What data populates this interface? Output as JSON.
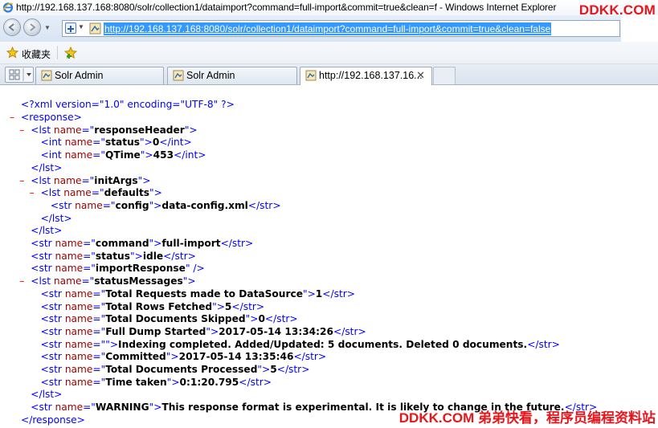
{
  "window": {
    "title": "http://192.168.137.168:8080/solr/collection1/dataimport?command=full-import&commit=true&clean=f - Windows Internet Explorer"
  },
  "watermark": {
    "top": "DDKK.COM",
    "bottom": "DDKK.COM 弟弟快看，程序员编程资料站"
  },
  "address": {
    "url": "http://192.168.137.168:8080/solr/collection1/dataimport?command=full-import&commit=true&clean=false"
  },
  "favorites": {
    "label": "收藏夹"
  },
  "tabs": [
    {
      "label": "Solr Admin"
    },
    {
      "label": "Solr Admin"
    },
    {
      "label": "http://192.168.137.16..."
    }
  ],
  "xml": {
    "declaration": "<?xml version=\"1.0\" encoding=\"UTF-8\" ?>",
    "lines": [
      {
        "collapse": true,
        "indent": 0,
        "kind": "open",
        "tag": "response"
      },
      {
        "collapse": true,
        "indent": 1,
        "kind": "open",
        "tag": "lst",
        "name": "responseHeader"
      },
      {
        "collapse": false,
        "indent": 2,
        "kind": "elem",
        "tag": "int",
        "name": "status",
        "value": "0"
      },
      {
        "collapse": false,
        "indent": 2,
        "kind": "elem",
        "tag": "int",
        "name": "QTime",
        "value": "453"
      },
      {
        "collapse": false,
        "indent": 1,
        "kind": "close",
        "tag": "lst"
      },
      {
        "collapse": true,
        "indent": 1,
        "kind": "open",
        "tag": "lst",
        "name": "initArgs"
      },
      {
        "collapse": true,
        "indent": 2,
        "kind": "open",
        "tag": "lst",
        "name": "defaults"
      },
      {
        "collapse": false,
        "indent": 3,
        "kind": "elem",
        "tag": "str",
        "name": "config",
        "value": "data-config.xml"
      },
      {
        "collapse": false,
        "indent": 2,
        "kind": "close",
        "tag": "lst"
      },
      {
        "collapse": false,
        "indent": 1,
        "kind": "close",
        "tag": "lst"
      },
      {
        "collapse": false,
        "indent": 1,
        "kind": "elem",
        "tag": "str",
        "name": "command",
        "value": "full-import"
      },
      {
        "collapse": false,
        "indent": 1,
        "kind": "elem",
        "tag": "str",
        "name": "status",
        "value": "idle"
      },
      {
        "collapse": false,
        "indent": 1,
        "kind": "empty",
        "tag": "str",
        "name": "importResponse"
      },
      {
        "collapse": true,
        "indent": 1,
        "kind": "open",
        "tag": "lst",
        "name": "statusMessages"
      },
      {
        "collapse": false,
        "indent": 2,
        "kind": "elem",
        "tag": "str",
        "name": "Total Requests made to DataSource",
        "value": "1"
      },
      {
        "collapse": false,
        "indent": 2,
        "kind": "elem",
        "tag": "str",
        "name": "Total Rows Fetched",
        "value": "5"
      },
      {
        "collapse": false,
        "indent": 2,
        "kind": "elem",
        "tag": "str",
        "name": "Total Documents Skipped",
        "value": "0"
      },
      {
        "collapse": false,
        "indent": 2,
        "kind": "elem",
        "tag": "str",
        "name": "Full Dump Started",
        "value": "2017-05-14 13:34:26"
      },
      {
        "collapse": false,
        "indent": 2,
        "kind": "elem",
        "tag": "str",
        "name": "",
        "value": "Indexing completed. Added/Updated: 5 documents. Deleted 0 documents."
      },
      {
        "collapse": false,
        "indent": 2,
        "kind": "elem",
        "tag": "str",
        "name": "Committed",
        "value": "2017-05-14 13:35:46"
      },
      {
        "collapse": false,
        "indent": 2,
        "kind": "elem",
        "tag": "str",
        "name": "Total Documents Processed",
        "value": "5"
      },
      {
        "collapse": false,
        "indent": 2,
        "kind": "elem",
        "tag": "str",
        "name": "Time taken",
        "value": "0:1:20.795"
      },
      {
        "collapse": false,
        "indent": 1,
        "kind": "close",
        "tag": "lst"
      },
      {
        "collapse": false,
        "indent": 1,
        "kind": "elem",
        "tag": "str",
        "name": "WARNING",
        "value": "This response format is experimental. It is likely to change in the future."
      },
      {
        "collapse": false,
        "indent": 0,
        "kind": "close",
        "tag": "response"
      }
    ]
  },
  "colors": {
    "tag": "#0000ff",
    "attribute": "#990000",
    "collapse": "#ff0000",
    "url_highlight": "#3399ff",
    "watermark": "#e8151b"
  }
}
